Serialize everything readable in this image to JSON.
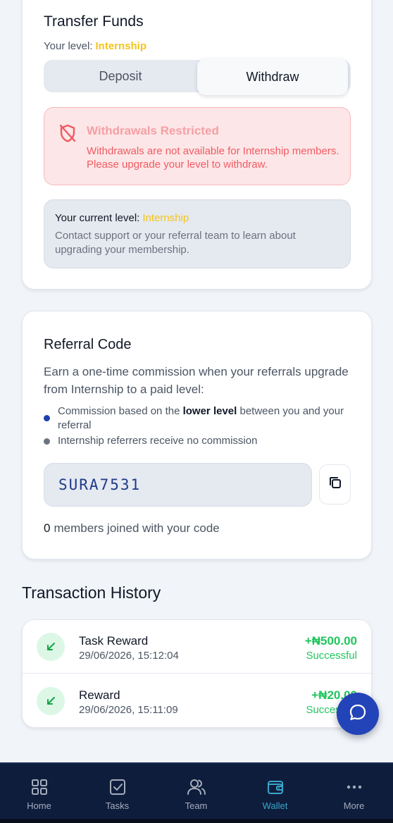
{
  "transfer": {
    "title": "Transfer Funds",
    "level_label": "Your level:",
    "level_value": "Internship",
    "tabs": [
      {
        "label": "Deposit",
        "active": false
      },
      {
        "label": "Withdraw",
        "active": true
      }
    ],
    "alert": {
      "icon": "shield-off-icon",
      "title": "Withdrawals Restricted",
      "body": "Withdrawals are not available for Internship members. Please upgrade your level to withdraw."
    },
    "info": {
      "title_label": "Your current level:",
      "title_value": "Internship",
      "body": "Contact support or your referral team to learn about upgrading your membership."
    }
  },
  "referral": {
    "title": "Referral Code",
    "description": "Earn a one-time commission when your referrals upgrade from Internship to a paid level:",
    "bullets": [
      {
        "pre": "Commission based on the ",
        "bold": "lower level",
        "post": " between you and your referral",
        "dot_color": "#1e40af"
      },
      {
        "pre": "Internship referrers receive no commission",
        "bold": "",
        "post": "",
        "dot_color": "#6b7280"
      }
    ],
    "code": "SURA7531",
    "copy_icon": "copy-icon",
    "members_count": "0",
    "members_text": "members joined with your code"
  },
  "history": {
    "title": "Transaction History",
    "transactions": [
      {
        "name": "Task Reward",
        "date": "29/06/2026, 15:12:04",
        "amount": "+₦500.00",
        "status": "Successful",
        "icon": "arrow-down-left-icon"
      },
      {
        "name": "Reward",
        "date": "29/06/2026, 15:11:09",
        "amount": "+₦20.00",
        "status": "Successful",
        "icon": "arrow-down-left-icon"
      }
    ]
  },
  "fab": {
    "icon": "chat-bubble-icon"
  },
  "nav": {
    "items": [
      {
        "label": "Home",
        "icon": "grid-icon",
        "active": false
      },
      {
        "label": "Tasks",
        "icon": "checkbox-icon",
        "active": false
      },
      {
        "label": "Team",
        "icon": "users-icon",
        "active": false
      },
      {
        "label": "Wallet",
        "icon": "wallet-icon",
        "active": true
      },
      {
        "label": "More",
        "icon": "more-dots-icon",
        "active": false
      }
    ]
  },
  "colors": {
    "accent": "#2344b8",
    "level_highlight": "#f5c518",
    "success": "#22c55e",
    "danger": "#ef5b63",
    "nav_bg": "#0f1d3d",
    "nav_active": "#3aa6c9"
  }
}
